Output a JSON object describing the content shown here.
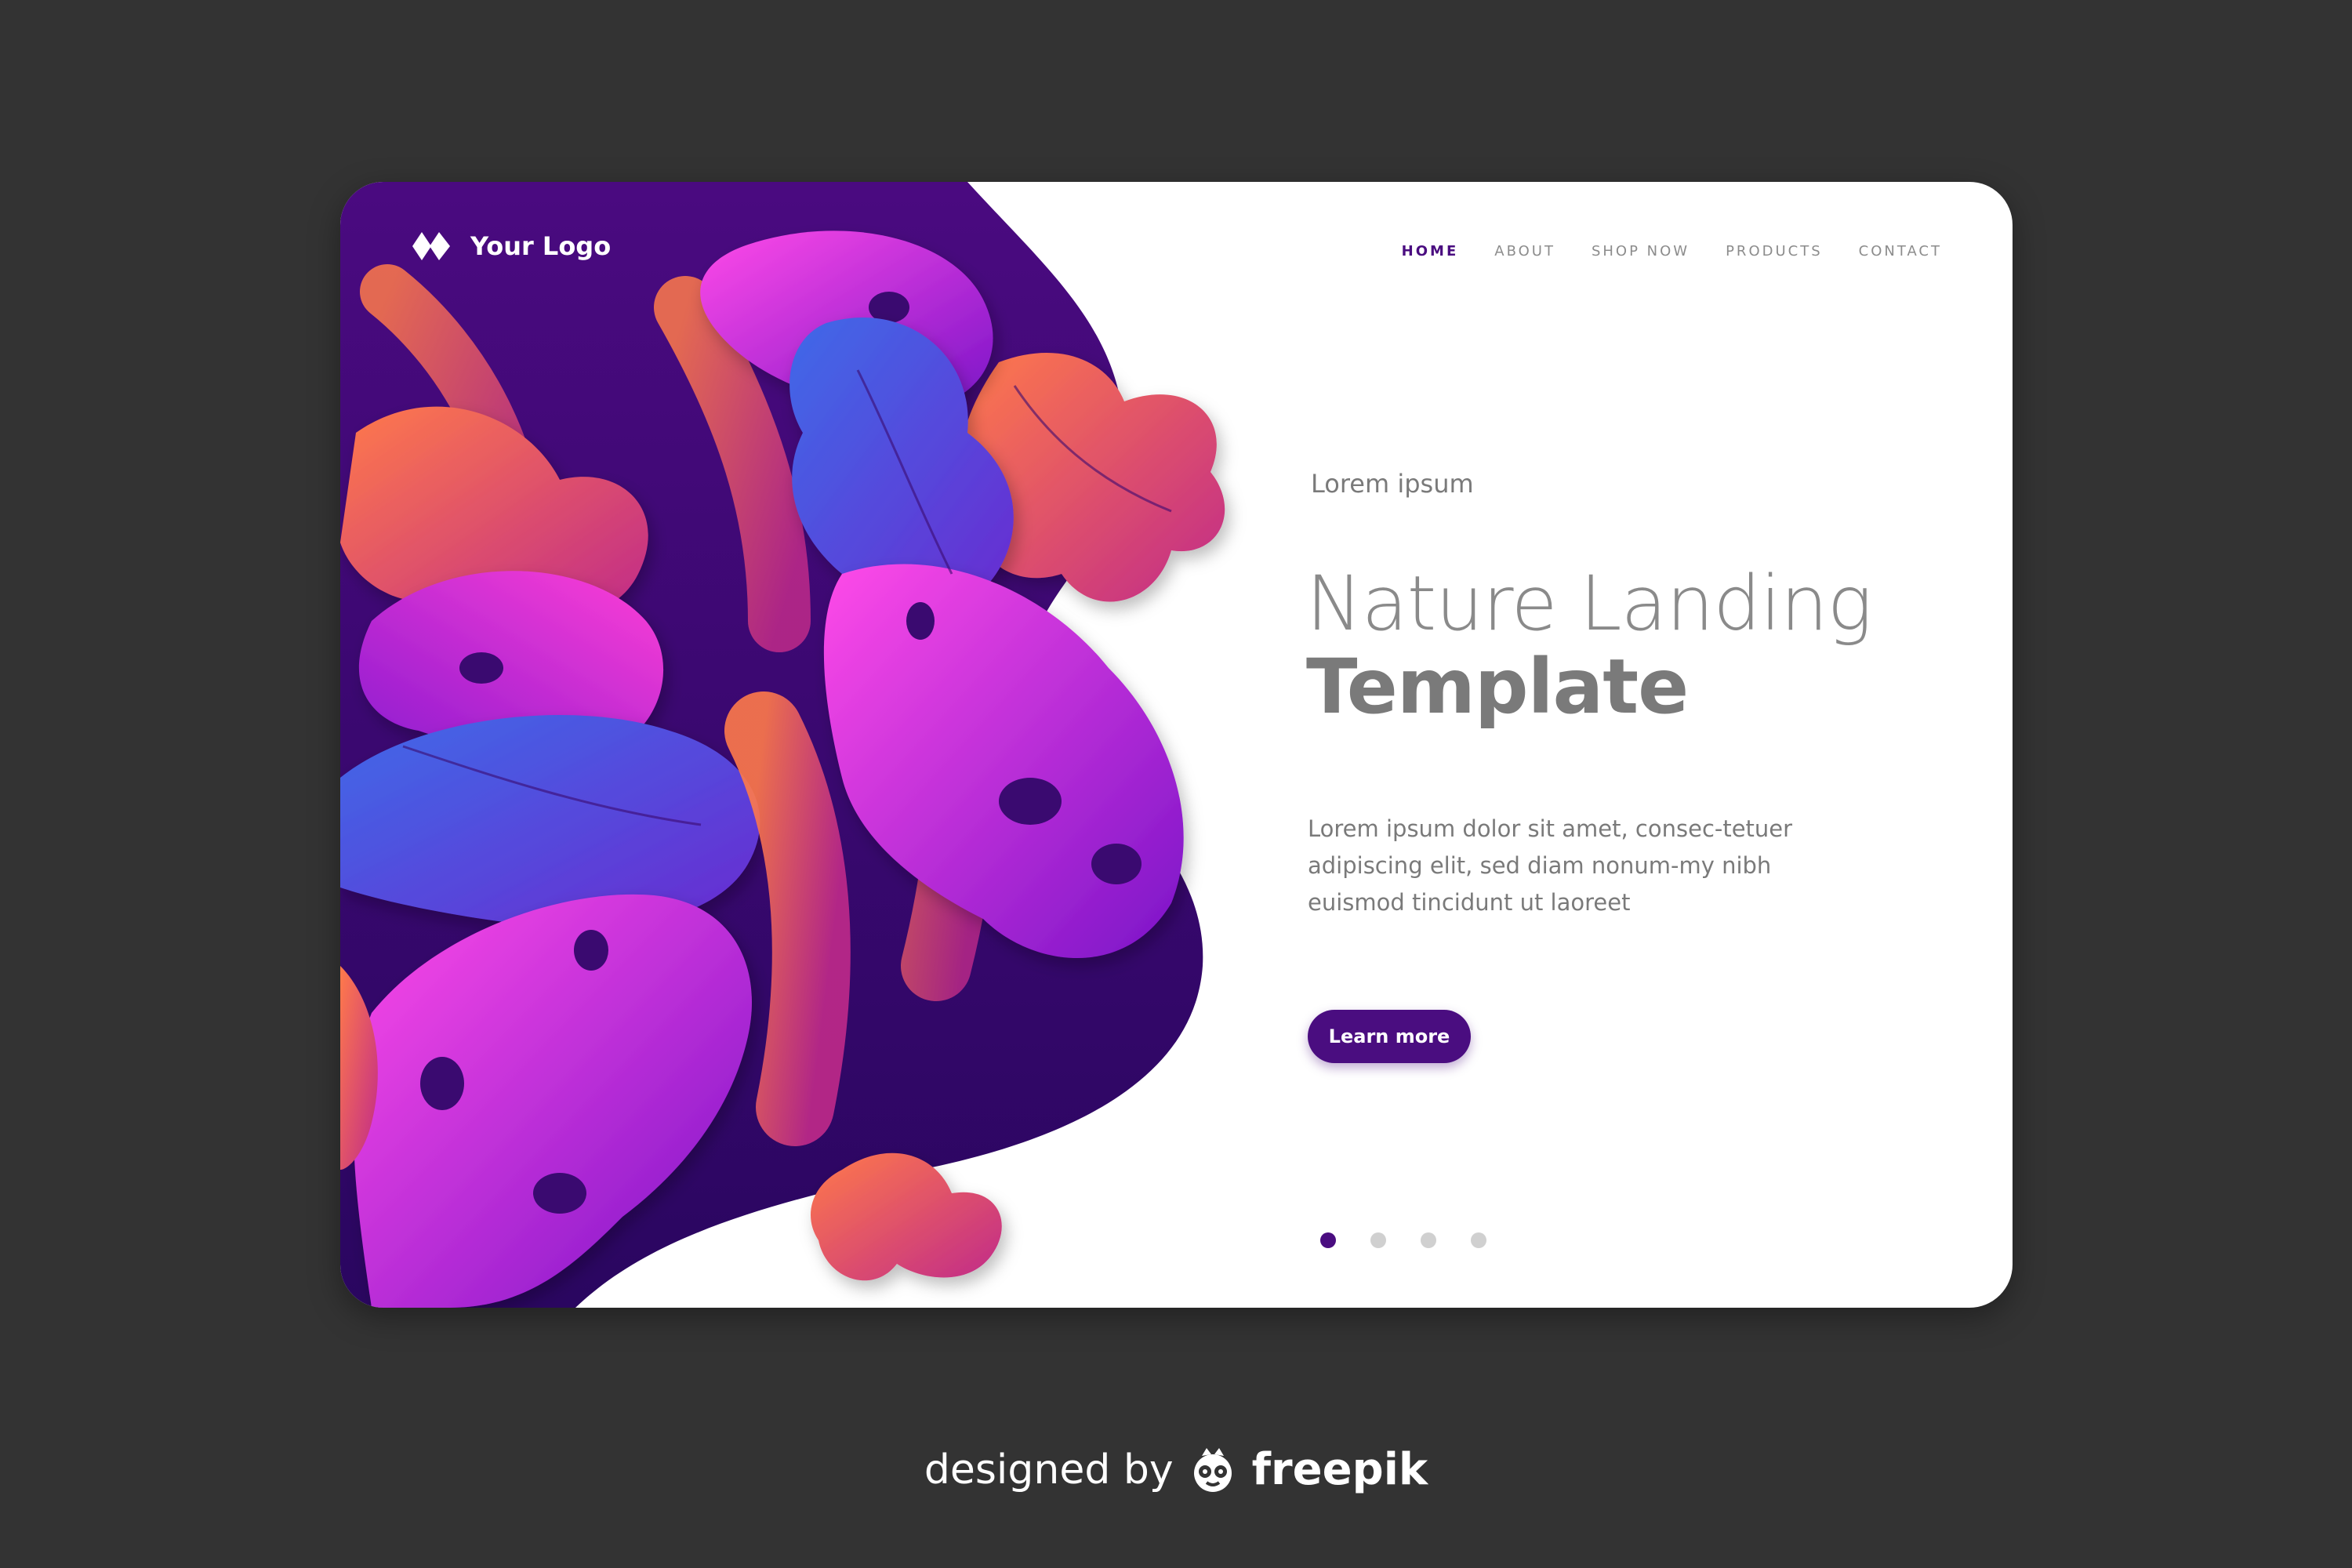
{
  "brand": {
    "logo_text": "Your Logo",
    "logo_icon": "diamond-logo-icon"
  },
  "nav": {
    "items": [
      {
        "label": "HOME",
        "active": true
      },
      {
        "label": "ABOUT",
        "active": false
      },
      {
        "label": "SHOP NOW",
        "active": false
      },
      {
        "label": "PRODUCTS",
        "active": false
      },
      {
        "label": "CONTACT",
        "active": false
      }
    ]
  },
  "hero": {
    "eyebrow": "Lorem ipsum",
    "title_light": "Nature Landing",
    "title_bold": "Template",
    "body": "Lorem ipsum dolor sit amet, consec-tetuer adipiscing elit, sed diam nonum-my nibh euismod tincidunt ut laoreet",
    "cta_label": "Learn more"
  },
  "slider": {
    "count": 4,
    "active_index": 0
  },
  "credit": {
    "prefix": "designed by",
    "brand": "freepik",
    "icon": "freepik-owl-icon"
  },
  "colors": {
    "page_background": "#333333",
    "card_background": "#ffffff",
    "accent": "#4a0d80",
    "text_gray": "#7a7a7a",
    "leaf_magenta": "#e030e0",
    "leaf_blue": "#4a5be0",
    "leaf_coral": "#f06050",
    "art_background": "#3a0a70"
  }
}
